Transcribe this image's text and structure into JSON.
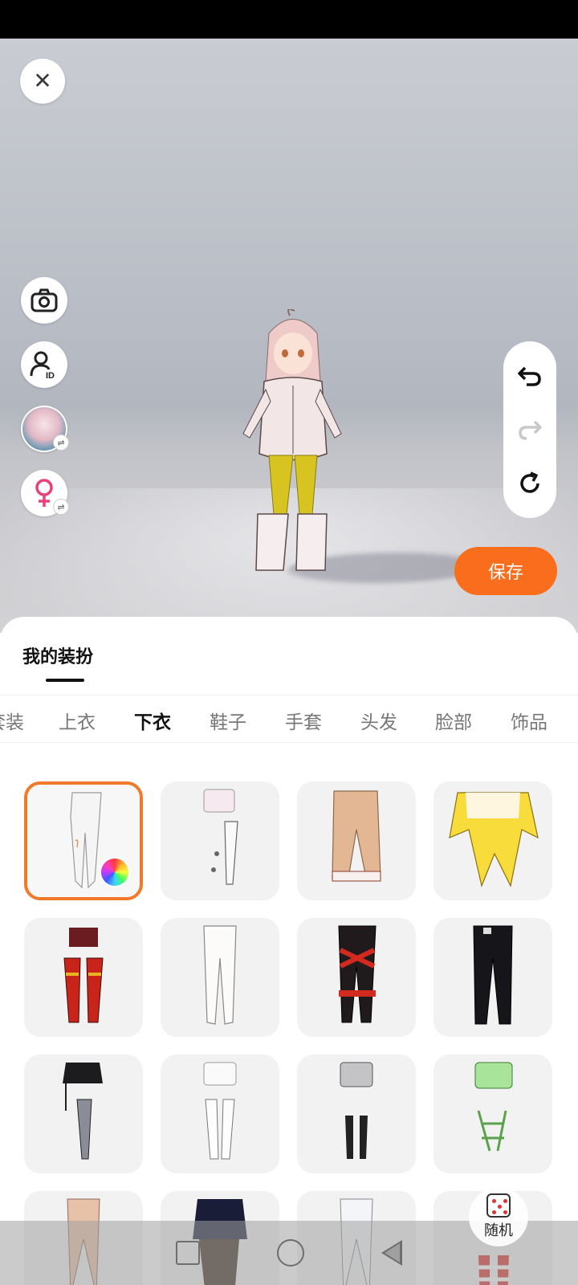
{
  "header": {
    "close_icon": "close-icon",
    "save_label": "保存"
  },
  "left_tools": [
    {
      "name": "camera",
      "icon": "camera-icon"
    },
    {
      "name": "avatar-id",
      "icon": "user-id-icon",
      "badge": "ID"
    },
    {
      "name": "character-swap",
      "icon": "character-avatar",
      "swap": "⇌"
    },
    {
      "name": "gender-swap",
      "icon": "female-icon",
      "swap": "⇌"
    }
  ],
  "history": {
    "undo": "undo-icon",
    "redo": "redo-icon",
    "reset": "reset-icon"
  },
  "sheet": {
    "title": "我的装扮",
    "tabs": [
      "套装",
      "上衣",
      "下衣",
      "鞋子",
      "手套",
      "头发",
      "脸部",
      "饰品"
    ],
    "active_tab": "下衣"
  },
  "random": {
    "label": "随机",
    "icon": "dice-icon"
  },
  "colors": {
    "accent": "#fa6d1c",
    "selected_border": "#f07a2a"
  }
}
